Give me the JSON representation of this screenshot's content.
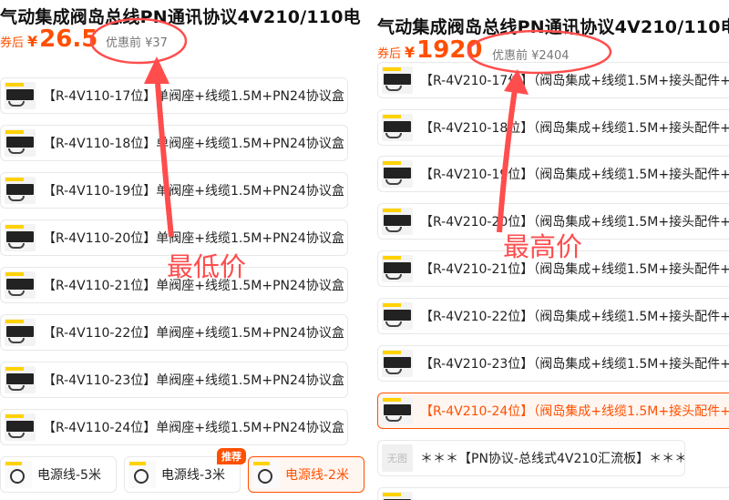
{
  "left": {
    "title": "气动集成阀岛总线PN通讯协议4V210/110电",
    "coupon_label": "券后",
    "currency": "¥",
    "price": "26.5",
    "original_price": "优惠前 ¥37",
    "skus": [
      {
        "label": "【R-4V110-17位】单阀座+线缆1.5M+PN24协议盒"
      },
      {
        "label": "【R-4V110-18位】单阀座+线缆1.5M+PN24协议盒"
      },
      {
        "label": "【R-4V110-19位】单阀座+线缆1.5M+PN24协议盒"
      },
      {
        "label": "【R-4V110-20位】单阀座+线缆1.5M+PN24协议盒"
      },
      {
        "label": "【R-4V110-21位】单阀座+线缆1.5M+PN24协议盒"
      },
      {
        "label": "【R-4V110-22位】单阀座+线缆1.5M+PN24协议盒"
      },
      {
        "label": "【R-4V110-23位】单阀座+线缆1.5M+PN24协议盒"
      },
      {
        "label": "【R-4V110-24位】单阀座+线缆1.5M+PN24协议盒"
      }
    ],
    "cables": [
      {
        "label": "电源线-5米"
      },
      {
        "label": "电源线-3米"
      },
      {
        "label": "电源线-2米"
      }
    ],
    "badge": "推荐"
  },
  "right": {
    "title": "气动集成阀岛总线PN通讯协议4V210/110电",
    "coupon_label": "券后",
    "currency": "¥",
    "price": "1920",
    "original_price": "优惠前 ¥2404",
    "skus": [
      {
        "label": "【R-4V210-17位】（阀岛集成+线缆1.5M+接头配件+"
      },
      {
        "label": "【R-4V210-18位】（阀岛集成+线缆1.5M+接头配件+"
      },
      {
        "label": "【R-4V210-19位】（阀岛集成+线缆1.5M+接头配件+"
      },
      {
        "label": "【R-4V210-20位】（阀岛集成+线缆1.5M+接头配件+"
      },
      {
        "label": "【R-4V210-21位】（阀岛集成+线缆1.5M+接头配件+"
      },
      {
        "label": "【R-4V210-22位】（阀岛集成+线缆1.5M+接头配件+"
      },
      {
        "label": "【R-4V210-23位】（阀岛集成+线缆1.5M+接头配件+"
      },
      {
        "label": "【R-4V210-24位】（阀岛集成+线缆1.5M+接头配件+"
      }
    ],
    "extra_item": {
      "thumb_text": "无图",
      "label": "＊＊＊【PN协议-总线式4V210汇流板】＊＊＊"
    }
  },
  "annotations": {
    "low": "最低价",
    "high": "最高价",
    "color": "#ff4d4d"
  },
  "colors": {
    "accent": "#ff5000",
    "selected_bg": "#fff6f1"
  }
}
